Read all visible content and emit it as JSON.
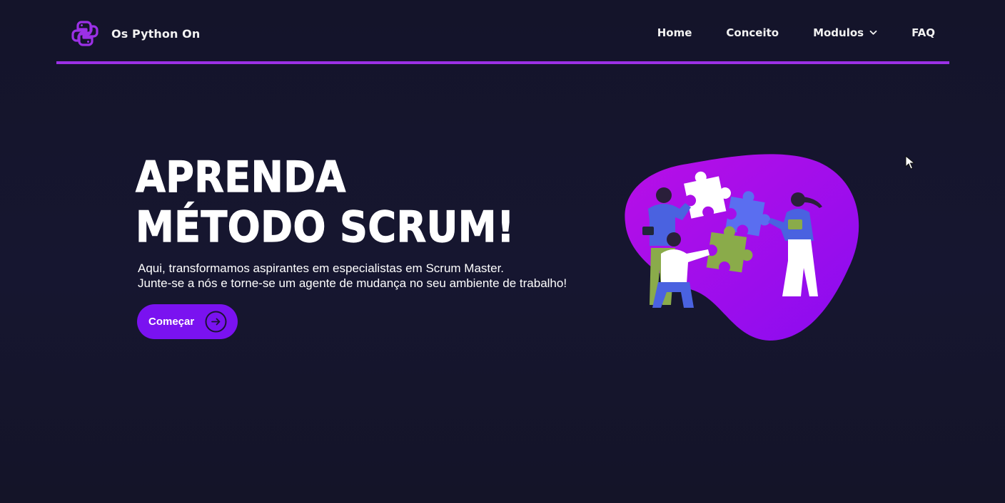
{
  "brand": {
    "name": "Os Python On",
    "icon": "python-logo-icon"
  },
  "nav": {
    "items": [
      {
        "label": "Home"
      },
      {
        "label": "Conceito"
      },
      {
        "label": "Modulos",
        "icon": "chevron-down-icon"
      },
      {
        "label": "FAQ"
      }
    ]
  },
  "hero": {
    "title_line1": "APRENDA",
    "title_line2": "MÉTODO SCRUM!",
    "desc_line1": "Aqui, transformamos aspirantes em especialistas em Scrum Master.",
    "desc_line2": "Junte-se a nós e torne-se um agente de mudança no seu ambiente de trabalho!",
    "cta_label": "Começar",
    "cta_icon": "arrow-right-circle-icon",
    "illustration": "team-puzzle-illustration"
  },
  "colors": {
    "background": "#16162b",
    "accent": "#9b30e6",
    "button": "#7a12f0",
    "blob": "#a40fe8",
    "text": "#ffffff"
  }
}
